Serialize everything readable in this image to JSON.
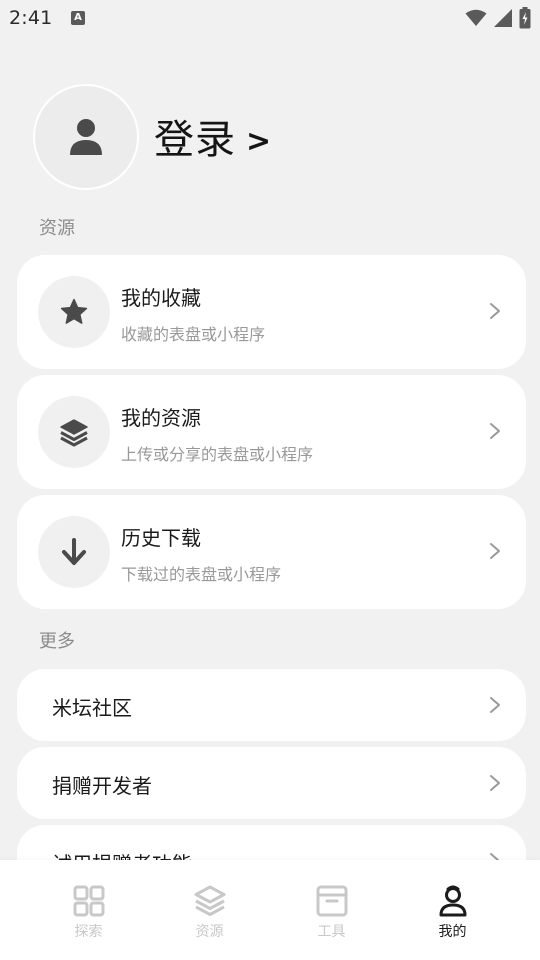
{
  "status_bar": {
    "time": "2:41",
    "indicator_letter": "A"
  },
  "profile": {
    "login_label": "登录",
    "login_arrow": ">"
  },
  "sections": {
    "resources_label": "资源",
    "more_label": "更多"
  },
  "resource_items": [
    {
      "title": "我的收藏",
      "subtitle": "收藏的表盘或小程序",
      "icon": "star-icon"
    },
    {
      "title": "我的资源",
      "subtitle": "上传或分享的表盘或小程序",
      "icon": "layers-icon"
    },
    {
      "title": "历史下载",
      "subtitle": "下载过的表盘或小程序",
      "icon": "download-arrow-icon"
    }
  ],
  "more_items": [
    {
      "title": "米坛社区"
    },
    {
      "title": "捐赠开发者"
    },
    {
      "title": "试用捐赠者功能"
    }
  ],
  "bottom_nav": [
    {
      "label": "探索",
      "icon": "grid-icon",
      "active": false
    },
    {
      "label": "资源",
      "icon": "layers-icon",
      "active": false
    },
    {
      "label": "工具",
      "icon": "archive-box-icon",
      "active": false
    },
    {
      "label": "我的",
      "icon": "user-icon",
      "active": true
    }
  ],
  "colors": {
    "background": "#f1f1f1",
    "card": "#ffffff",
    "icon_dark": "#4a4a4a",
    "nav_inactive": "#c8c8c8",
    "nav_active": "#1b1b1b"
  }
}
